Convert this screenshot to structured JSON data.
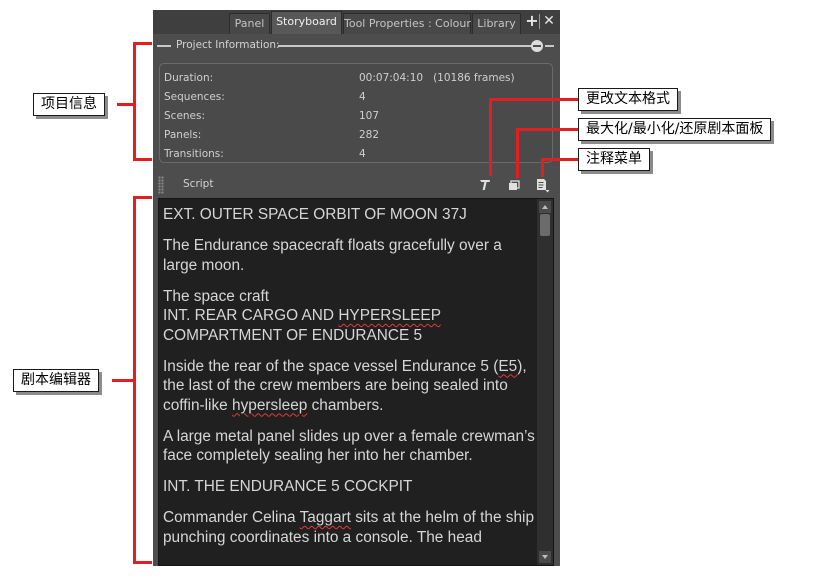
{
  "tabs": [
    {
      "label": "Panel",
      "active": false
    },
    {
      "label": "Storyboard",
      "active": true
    },
    {
      "label": "Tool Properties : Colour",
      "active": false
    },
    {
      "label": "Library",
      "active": false
    }
  ],
  "window_buttons": {
    "add": "+",
    "close": "✕"
  },
  "project_info": {
    "title": "Project Information:",
    "rows": [
      {
        "label": "Duration:",
        "value": "00:07:04:10   (10186 frames)"
      },
      {
        "label": "Sequences:",
        "value": "4"
      },
      {
        "label": "Scenes:",
        "value": "107"
      },
      {
        "label": "Panels:",
        "value": "282"
      },
      {
        "label": "Transitions:",
        "value": "4"
      }
    ]
  },
  "script_toolbar": {
    "label": "Script",
    "icons": [
      "text-format-icon",
      "maximize-icon",
      "notes-menu-icon"
    ]
  },
  "script_paragraphs": [
    "EXT. OUTER SPACE ORBIT OF MOON 37J",
    "The Endurance spacecraft floats gracefully over a large moon.",
    "The space craft\nINT. REAR CARGO AND HYPERSLEEP COMPARTMENT OF ENDURANCE 5",
    "Inside the rear of the space vessel Endurance 5 (E5), the last of the crew members are being sealed into coffin-like hypersleep chambers.",
    "A large metal panel slides up over a female crewman’s face completely sealing her into her chamber.",
    "INT. THE ENDURANCE 5 COCKPIT",
    "Commander Celina Taggart sits at the helm of the ship punching coordinates into a console. The head"
  ],
  "callouts": {
    "project_info": "项目信息",
    "format_text": "更改文本格式",
    "maximize": "最大化/最小化/还原剧本面板",
    "notes_menu": "注释菜单",
    "script_editor": "剧本编辑器"
  },
  "colors": {
    "callout_line": "#e21e1e",
    "panel_bg": "#4d4d4d",
    "editor_bg": "#202020",
    "editor_text": "#d6d6d6",
    "spellcheck": "#e23a3a"
  }
}
